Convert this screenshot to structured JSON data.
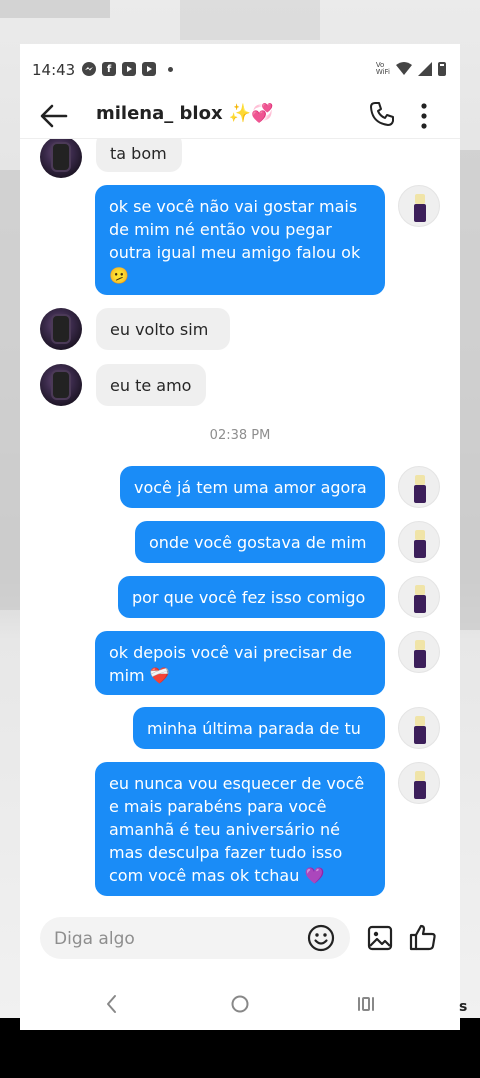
{
  "status_bar": {
    "time": "14:43",
    "left_icons": [
      "messenger-icon",
      "facebook-icon",
      "youtube-icon",
      "youtube-icon"
    ],
    "right_icons": [
      "volte-wifi-icon",
      "wifi-icon",
      "signal-icon",
      "battery-icon"
    ],
    "volte_label_1": "Vo",
    "volte_label_2": "WiFi"
  },
  "header": {
    "title": "milena_ blox ✨💞"
  },
  "messages": [
    {
      "side": "in",
      "text": "ta bom"
    },
    {
      "side": "out",
      "text": "ok se você não vai gostar mais de mim né então vou pegar outra igual meu amigo falou ok 🫤"
    },
    {
      "side": "in",
      "text": "eu volto sim"
    },
    {
      "side": "in",
      "text": "eu te amo"
    },
    {
      "timestamp": "02:38 PM"
    },
    {
      "side": "out",
      "text": "você já tem uma amor agora"
    },
    {
      "side": "out",
      "text": "onde você gostava de mim"
    },
    {
      "side": "out",
      "text": "por que você fez isso comigo"
    },
    {
      "side": "out",
      "text": "ok depois você vai precisar de mim ❤️‍🩹"
    },
    {
      "side": "out",
      "text": "minha última parada de tu"
    },
    {
      "side": "out",
      "text": "eu nunca vou esquecer de você e mais parabéns para você amanhã é teu aniversário né mas desculpa fazer tudo isso com você mas ok tchau 💜"
    }
  ],
  "composer": {
    "placeholder": "Diga algo"
  },
  "edge_text": "s",
  "colors": {
    "outgoing_bubble": "#1a8cf7",
    "incoming_bubble": "#efefef",
    "timestamp": "#8e8e8e"
  }
}
